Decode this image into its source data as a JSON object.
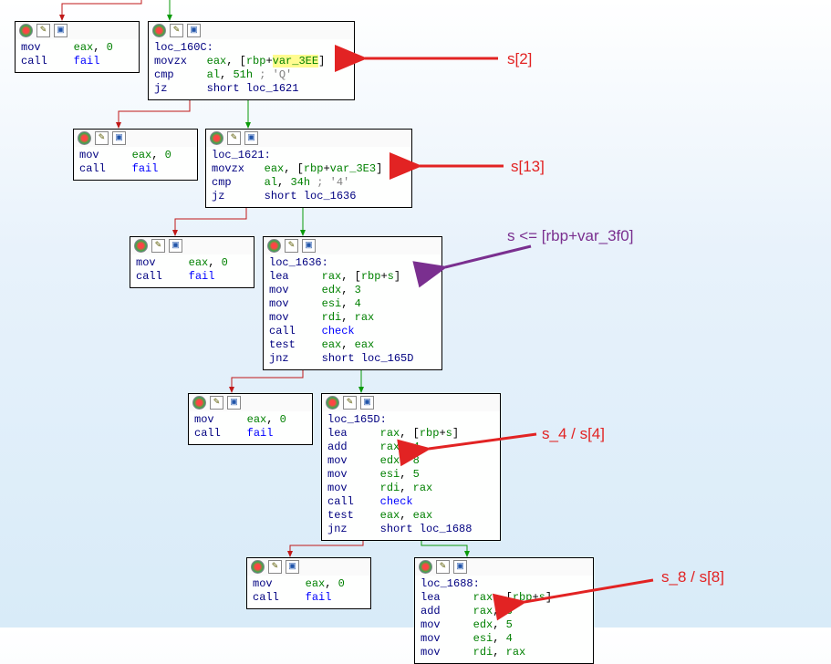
{
  "blocks": {
    "fail1": {
      "lines": [
        {
          "op": "mov",
          "args": [
            "eax",
            ", ",
            "0"
          ]
        },
        {
          "op": "call",
          "args": [
            "fail"
          ]
        }
      ]
    },
    "s2_block": {
      "label": "loc_160C:",
      "lines": [
        {
          "op": "movzx",
          "args": [
            "eax",
            ", [",
            "rbp",
            "+",
            "var_3EE",
            "]"
          ],
          "hl": "var_3EE"
        },
        {
          "op": "cmp",
          "args": [
            "al",
            ", ",
            "51h",
            " ; 'Q'"
          ]
        },
        {
          "op": "jz",
          "args": [
            "short ",
            "loc_1621"
          ]
        }
      ]
    },
    "fail2": {
      "lines": [
        {
          "op": "mov",
          "args": [
            "eax",
            ", ",
            "0"
          ]
        },
        {
          "op": "call",
          "args": [
            "fail"
          ]
        }
      ]
    },
    "s13_block": {
      "label": "loc_1621:",
      "lines": [
        {
          "op": "movzx",
          "args": [
            "eax",
            ", [",
            "rbp",
            "+",
            "var_3E3",
            "]"
          ]
        },
        {
          "op": "cmp",
          "args": [
            "al",
            ", ",
            "34h",
            " ; '4'"
          ]
        },
        {
          "op": "jz",
          "args": [
            "short ",
            "loc_1636"
          ]
        }
      ]
    },
    "fail3": {
      "lines": [
        {
          "op": "mov",
          "args": [
            "eax",
            ", ",
            "0"
          ]
        },
        {
          "op": "call",
          "args": [
            "fail"
          ]
        }
      ]
    },
    "s_block": {
      "label": "loc_1636:",
      "lines": [
        {
          "op": "lea",
          "args": [
            "rax",
            ", [",
            "rbp",
            "+",
            "s",
            "]"
          ]
        },
        {
          "op": "mov",
          "args": [
            "edx",
            ", ",
            "3"
          ]
        },
        {
          "op": "mov",
          "args": [
            "esi",
            ", ",
            "4"
          ]
        },
        {
          "op": "mov",
          "args": [
            "rdi",
            ", ",
            "rax"
          ]
        },
        {
          "op": "call",
          "args": [
            "check"
          ]
        },
        {
          "op": "test",
          "args": [
            "eax",
            ", ",
            "eax"
          ]
        },
        {
          "op": "jnz",
          "args": [
            "short ",
            "loc_165D"
          ]
        }
      ]
    },
    "fail4": {
      "lines": [
        {
          "op": "mov",
          "args": [
            "eax",
            ", ",
            "0"
          ]
        },
        {
          "op": "call",
          "args": [
            "fail"
          ]
        }
      ]
    },
    "s4_block": {
      "label": "loc_165D:",
      "lines": [
        {
          "op": "lea",
          "args": [
            "rax",
            ", [",
            "rbp",
            "+",
            "s",
            "]"
          ]
        },
        {
          "op": "add",
          "args": [
            "rax",
            ", ",
            "4"
          ]
        },
        {
          "op": "mov",
          "args": [
            "edx",
            ", ",
            "8"
          ]
        },
        {
          "op": "mov",
          "args": [
            "esi",
            ", ",
            "5"
          ]
        },
        {
          "op": "mov",
          "args": [
            "rdi",
            ", ",
            "rax"
          ]
        },
        {
          "op": "call",
          "args": [
            "check"
          ]
        },
        {
          "op": "test",
          "args": [
            "eax",
            ", ",
            "eax"
          ]
        },
        {
          "op": "jnz",
          "args": [
            "short ",
            "loc_1688"
          ]
        }
      ]
    },
    "fail5": {
      "lines": [
        {
          "op": "mov",
          "args": [
            "eax",
            ", ",
            "0"
          ]
        },
        {
          "op": "call",
          "args": [
            "fail"
          ]
        }
      ]
    },
    "s8_block": {
      "label": "loc_1688:",
      "lines": [
        {
          "op": "lea",
          "args": [
            "rax",
            ", [",
            "rbp",
            "+",
            "s",
            "]"
          ]
        },
        {
          "op": "add",
          "args": [
            "rax",
            ", ",
            "8"
          ]
        },
        {
          "op": "mov",
          "args": [
            "edx",
            ", ",
            "5"
          ]
        },
        {
          "op": "mov",
          "args": [
            "esi",
            ", ",
            "4"
          ]
        },
        {
          "op": "mov",
          "args": [
            "rdi",
            ", ",
            "rax"
          ]
        }
      ]
    }
  },
  "annotations": {
    "s2": "s[2]",
    "s13": "s[13]",
    "s_ptr": "s <= [rbp+var_3f0]",
    "s4": "s_4 / s[4]",
    "s8": "s_8 / s[8]"
  }
}
